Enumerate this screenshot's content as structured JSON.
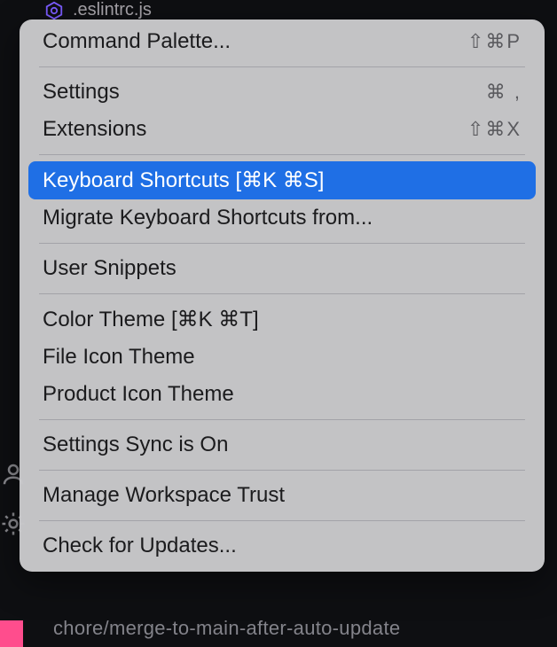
{
  "background": {
    "file_label": ".eslintrc.js",
    "bottom_text": "chore/merge-to-main-after-auto-update"
  },
  "menu": {
    "groups": [
      [
        {
          "label": "Command Palette...",
          "shortcut": "⇧⌘P",
          "highlighted": false
        }
      ],
      [
        {
          "label": "Settings",
          "shortcut": "⌘ ,",
          "highlighted": false
        },
        {
          "label": "Extensions",
          "shortcut": "⇧⌘X",
          "highlighted": false
        }
      ],
      [
        {
          "label": "Keyboard Shortcuts [⌘K ⌘S]",
          "shortcut": "",
          "highlighted": true
        },
        {
          "label": "Migrate Keyboard Shortcuts from...",
          "shortcut": "",
          "highlighted": false
        }
      ],
      [
        {
          "label": "User Snippets",
          "shortcut": "",
          "highlighted": false
        }
      ],
      [
        {
          "label": "Color Theme [⌘K ⌘T]",
          "shortcut": "",
          "highlighted": false
        },
        {
          "label": "File Icon Theme",
          "shortcut": "",
          "highlighted": false
        },
        {
          "label": "Product Icon Theme",
          "shortcut": "",
          "highlighted": false
        }
      ],
      [
        {
          "label": "Settings Sync is On",
          "shortcut": "",
          "highlighted": false
        }
      ],
      [
        {
          "label": "Manage Workspace Trust",
          "shortcut": "",
          "highlighted": false
        }
      ],
      [
        {
          "label": "Check for Updates...",
          "shortcut": "",
          "highlighted": false
        }
      ]
    ]
  }
}
